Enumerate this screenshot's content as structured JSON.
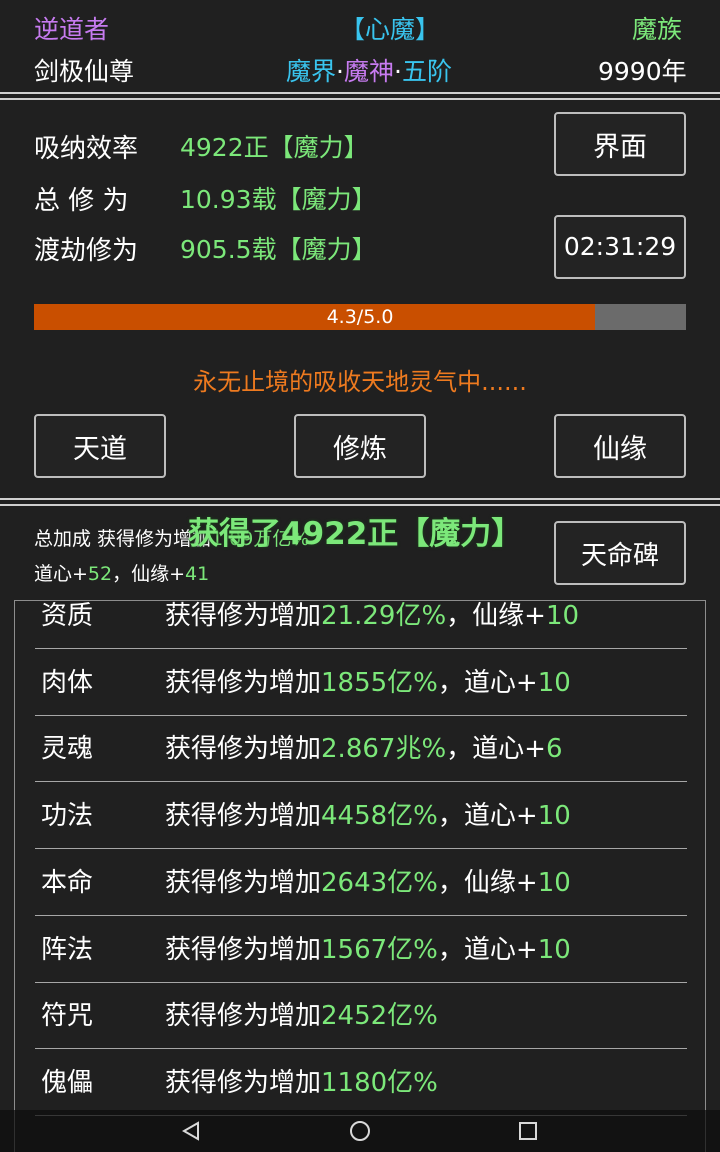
{
  "header": {
    "player_name": "逆道者",
    "state": "【心魔】",
    "race": "魔族",
    "title": "剑极仙尊",
    "realm_1": "魔界",
    "realm_2": "魔神",
    "realm_3": "五阶",
    "dot": "·",
    "years": "9990年"
  },
  "stats": {
    "absorb_label": "吸纳效率",
    "absorb_value": "4922正【魔力】",
    "total_label": "总 修 为",
    "total_value": "10.93载【魔力】",
    "tribulation_label": "渡劫修为",
    "tribulation_value": "905.5载【魔力】",
    "interface_button": "界面",
    "timer": "02:31:29"
  },
  "progress": {
    "text": "4.3/5.0",
    "fraction": 0.86
  },
  "status_message": "永无止境的吸收天地灵气中......",
  "actions": {
    "tiandao": "天道",
    "cultivate": "修炼",
    "xianyuan": "仙缘"
  },
  "bonus": {
    "total_label": "总加成 获得修为增加",
    "total_value": "1.09万亿%",
    "daoxin_label": "道心+",
    "daoxin_value": "52",
    "sep": "，",
    "xianyuan_label": "仙缘+",
    "xianyuan_value": "41",
    "tianmingbei_button": "天命碑"
  },
  "toast": "获得了4922正【魔力】",
  "rows": [
    {
      "name": "资质",
      "prefix": "获得修为增加",
      "value": "21.29亿%",
      "bonus_label": "，仙缘+",
      "bonus_value": "10"
    },
    {
      "name": "肉体",
      "prefix": "获得修为增加",
      "value": "1855亿%",
      "bonus_label": "，道心+",
      "bonus_value": "10"
    },
    {
      "name": "灵魂",
      "prefix": "获得修为增加",
      "value": "2.867兆%",
      "bonus_label": "，道心+",
      "bonus_value": "6"
    },
    {
      "name": "功法",
      "prefix": "获得修为增加",
      "value": "4458亿%",
      "bonus_label": "，道心+",
      "bonus_value": "10"
    },
    {
      "name": "本命",
      "prefix": "获得修为增加",
      "value": "2643亿%",
      "bonus_label": "，仙缘+",
      "bonus_value": "10"
    },
    {
      "name": "阵法",
      "prefix": "获得修为增加",
      "value": "1567亿%",
      "bonus_label": "，道心+",
      "bonus_value": "10"
    },
    {
      "name": "符咒",
      "prefix": "获得修为增加",
      "value": "2452亿%",
      "bonus_label": "",
      "bonus_value": ""
    },
    {
      "name": "傀儡",
      "prefix": "获得修为增加",
      "value": "1180亿%",
      "bonus_label": "",
      "bonus_value": ""
    }
  ],
  "nav": {
    "back": "back-triangle-icon",
    "home": "home-circle-icon",
    "recents": "recents-square-icon"
  },
  "colors": {
    "background": "#202020",
    "green": "#7ce87a",
    "purple": "#c77bf0",
    "cyan": "#39c4ee",
    "orange": "#ee7a1f",
    "progress_fill": "#c94f00"
  }
}
